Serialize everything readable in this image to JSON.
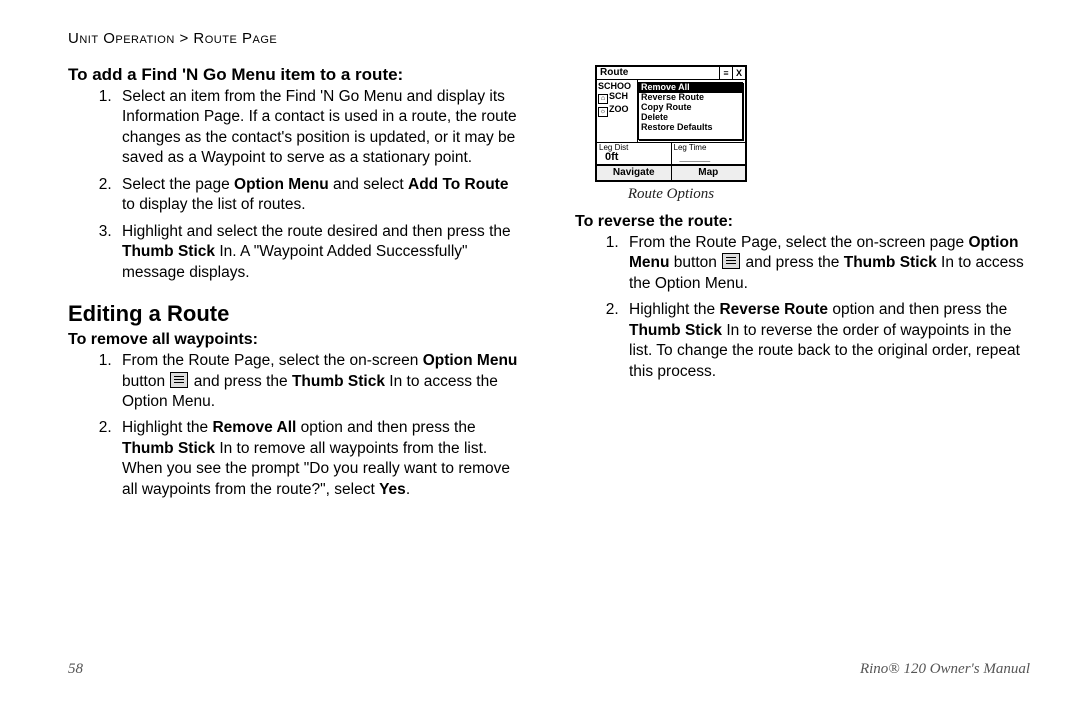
{
  "breadcrumb": {
    "section": "Unit Operation",
    "sep": " > ",
    "page": "Route Page"
  },
  "left": {
    "h_add": "To add a Find 'N Go Menu item to a route:",
    "add_steps": {
      "s1": "Select an item from the Find 'N Go Menu and display its Information Page. If a contact is used in a route, the route changes as the contact's position is updated, or it may be saved as a Waypoint to serve as a stationary point.",
      "s2_a": "Select the page ",
      "s2_b": "Option Menu",
      "s2_c": " and select ",
      "s2_d": "Add To Route",
      "s2_e": " to display the list of routes.",
      "s3_a": "Highlight and select the route desired and then press the ",
      "s3_b": "Thumb Stick",
      "s3_c": " In. A \"Waypoint Added Successfully\" message displays."
    },
    "h_edit": "Editing a Route",
    "h_remove": "To remove all waypoints:",
    "remove_steps": {
      "s1_a": "From the Route Page, select the on-screen ",
      "s1_b": "Option Menu",
      "s1_c": " button ",
      "s1_d": " and press the ",
      "s1_e": "Thumb Stick",
      "s1_f": " In to access the Option Menu.",
      "s2_a": "Highlight the ",
      "s2_b": "Remove All",
      "s2_c": " option and then press the ",
      "s2_d": "Thumb Stick",
      "s2_e": " In to remove all waypoints from the list. When you see the prompt \"Do you really want to remove all waypoints from the route?\", select ",
      "s2_f": "Yes",
      "s2_g": "."
    }
  },
  "right": {
    "device": {
      "title": "Route",
      "left_items": [
        "SCHOO",
        "SCH",
        "ZOO"
      ],
      "menu": [
        "Remove All",
        "Reverse Route",
        "Copy Route",
        "Delete",
        "Restore Defaults"
      ],
      "selected_menu_index": 0,
      "stat1_label": "Leg Dist",
      "stat1_value": "0ft",
      "stat2_label": "Leg Time",
      "stat2_value": "_____",
      "btn1": "Navigate",
      "btn2": "Map"
    },
    "caption": "Route Options",
    "h_reverse": "To reverse the route:",
    "reverse_steps": {
      "s1_a": "From the Route Page, select the on-screen page ",
      "s1_b": "Option Menu",
      "s1_c": " button ",
      "s1_d": " and press the ",
      "s1_e": "Thumb Stick",
      "s1_f": " In to access the Option Menu.",
      "s2_a": "Highlight the ",
      "s2_b": "Reverse Route",
      "s2_c": " option and then press the ",
      "s2_d": "Thumb Stick",
      "s2_e": " In to reverse the order of waypoints in the list. To change the route back to the original order, repeat this process."
    }
  },
  "footer": {
    "page": "58",
    "manual": "Rino® 120 Owner's Manual"
  }
}
